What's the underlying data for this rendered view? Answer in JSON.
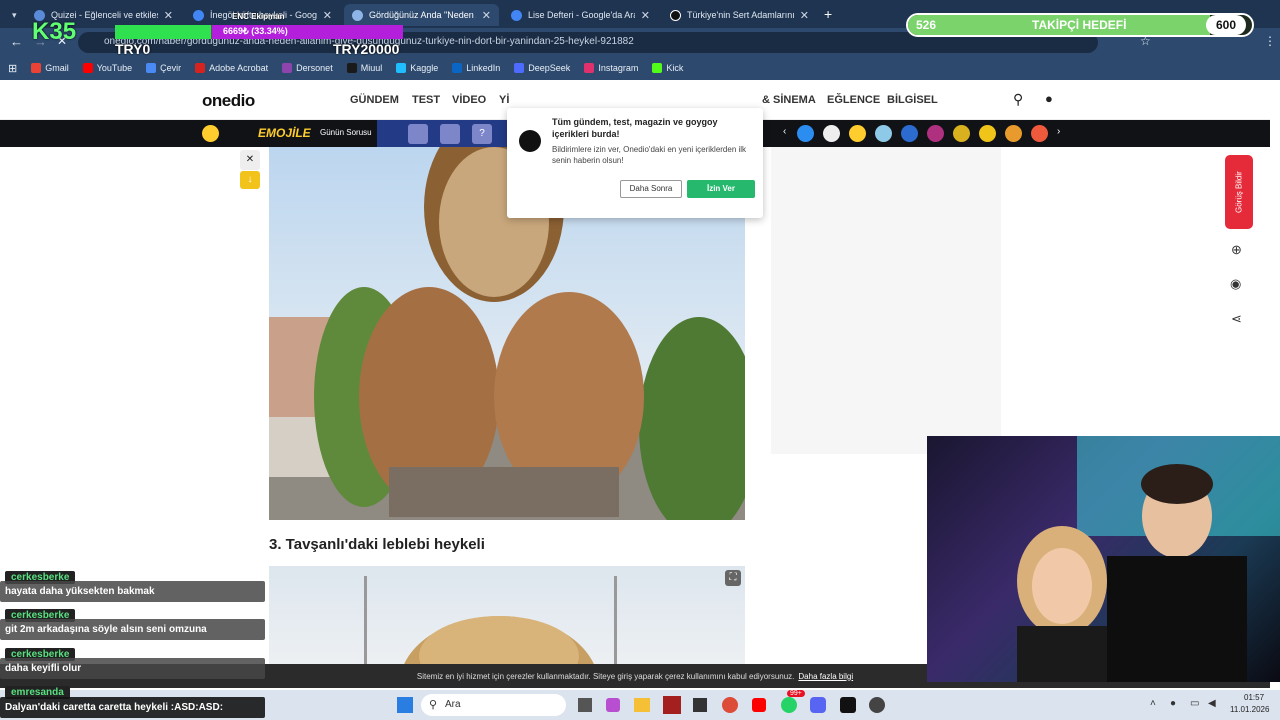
{
  "browser": {
    "tabs": [
      {
        "title": "Quizei - Eğlenceli ve etkileşimli",
        "active": false
      },
      {
        "title": "İnegöl köfte heykeli - Google",
        "active": false
      },
      {
        "title": "Gördüğünüz Anda \"Neden Allah",
        "active": true
      },
      {
        "title": "Lise Defteri - Google'da Ara",
        "active": false
      },
      {
        "title": "Türkiye'nin Sert Adamlarının Çı",
        "active": false
      }
    ],
    "url": "onedio.com/haber/gordugunuz-anda-neden-allahim-diye-dusundugunuz-turkiye-nin-dort-bir-yanindan-25-heykel-921882",
    "bookmarks": [
      {
        "label": "Gmail",
        "color": "#ea4335"
      },
      {
        "label": "YouTube",
        "color": "#ff0000"
      },
      {
        "label": "Çevir",
        "color": "#4a8af4"
      },
      {
        "label": "Adobe Acrobat",
        "color": "#d6231f"
      },
      {
        "label": "Dersonet",
        "color": "#8e44ad"
      },
      {
        "label": "Miuul",
        "color": "#1a1a1a"
      },
      {
        "label": "Kaggle",
        "color": "#20beff"
      },
      {
        "label": "LinkedIn",
        "color": "#0a66c2"
      },
      {
        "label": "DeepSeek",
        "color": "#4d6bfe"
      },
      {
        "label": "Instagram",
        "color": "#e1306c"
      },
      {
        "label": "Kick",
        "color": "#53fc18"
      }
    ]
  },
  "site": {
    "logo": "onedio",
    "nav": [
      "GÜNDEM",
      "TEST",
      "VİDEO",
      "Yİ",
      "& SİNEMA",
      "EĞLENCE",
      "BİLGİSEL"
    ],
    "strip": {
      "emojile": "EMOJİLE",
      "gunun_sorusu": "Günün Sorusu"
    },
    "notification": {
      "title": "Tüm gündem, test, magazin ve goygoy içerikleri burda!",
      "body": "Bildirimlere izin ver, Onedio'daki en yeni içeriklerden ilk senin haberin olsun!",
      "later": "Daha Sonra",
      "allow": "İzin Ver"
    },
    "heading3": "3. Tavşanlı'daki leblebi heykeli",
    "feedback": "Görüş Bildir",
    "cookie_text": "Sitemiz en iyi hizmet için çerezler kullanmaktadır. Siteye giriş yaparak çerez kullanımını kabul ediyorsunuz.",
    "cookie_link": "Daha fazla bilgi"
  },
  "stream": {
    "goal_label": "TAKİPÇİ HEDEFİ",
    "goal_current": "526",
    "goal_target": "600",
    "goal_fraction": 0.877,
    "k_count": "35",
    "try0": "TRY0",
    "try20000": "TRY20000",
    "donor": "ENC Ekipman",
    "progress_text": "6669₺ (33.34%)",
    "progress_fraction": 0.3334,
    "chat": [
      {
        "user": "cerkesberke",
        "message": "hayata daha yüksekten bakmak"
      },
      {
        "user": "cerkesberke",
        "message": "git 2m arkadaşına söyle alsın seni omzuna"
      },
      {
        "user": "cerkesberke",
        "message": "daha keyifli olur"
      },
      {
        "user": "emresanda",
        "message": "Dalyan'daki caretta caretta heykeli :ASD:ASD:"
      }
    ]
  },
  "taskbar": {
    "search": "Ara",
    "time": "01:57",
    "date": "11.01.2026",
    "badge": "99+"
  }
}
